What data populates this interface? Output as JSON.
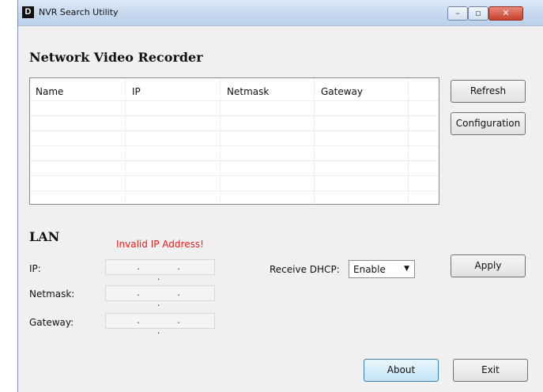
{
  "window": {
    "title": "NVR Search Utility",
    "app_icon_letter": "D",
    "controls": {
      "minimize": "–",
      "maximize": "▫",
      "close": "✕"
    }
  },
  "device_section": {
    "title": "Network Video Recorder",
    "table": {
      "columns": [
        "Name",
        "IP",
        "Netmask",
        "Gateway",
        ""
      ],
      "rows": []
    }
  },
  "buttons": {
    "refresh": "Refresh",
    "configuration": "Configuration",
    "apply": "Apply",
    "about": "About",
    "exit": "Exit"
  },
  "lan_section": {
    "title": "LAN",
    "error_message": "Invalid IP Address!",
    "ip_label": "IP:",
    "netmask_label": "Netmask:",
    "gateway_label": "Gateway:",
    "ip_value": ". . .",
    "netmask_value": ". . .",
    "gateway_value": ". . .",
    "dhcp_label": "Receive DHCP:",
    "dhcp_selected": "Enable"
  }
}
